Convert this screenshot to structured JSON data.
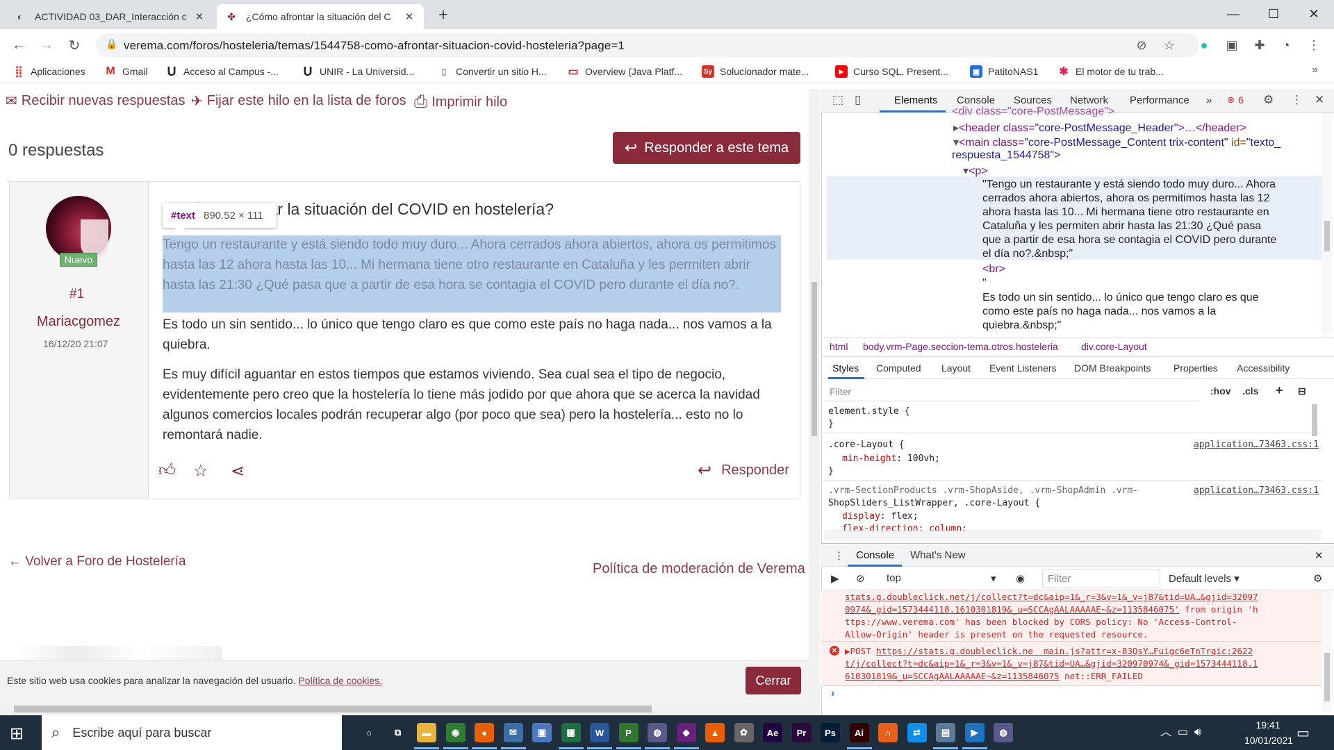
{
  "browser": {
    "tabs": [
      {
        "title": "ACTIVIDAD 03_DAR_Interacción c",
        "favicon": "moodle-icon",
        "active": false
      },
      {
        "title": "¿Cómo afrontar la situación del C",
        "favicon": "verema-icon",
        "active": true
      }
    ],
    "new_tab": "+",
    "window_controls": {
      "minimize": "—",
      "maximize": "☐",
      "close": "✕"
    },
    "url": "verema.com/foros/hosteleria/temas/1544758-como-afrontar-situacion-covid-hosteleria?page=1",
    "bookmarks": [
      {
        "label": "Aplicaciones",
        "icon": "apps-icon",
        "color": "#e94235"
      },
      {
        "label": "Gmail",
        "icon": "gmail-icon",
        "color": "#d93025"
      },
      {
        "label": "Acceso al Campus -...",
        "icon": "unir-icon",
        "color": "#222222"
      },
      {
        "label": "UNIR - La Universid...",
        "icon": "unir-icon",
        "color": "#222222"
      },
      {
        "label": "Convertir un sitio H...",
        "icon": "page-icon",
        "color": "#888888"
      },
      {
        "label": "Overview (Java Platf...",
        "icon": "oracle-icon",
        "color": "#e01b1b"
      },
      {
        "label": "Solucionador mate...",
        "icon": "symbolab-icon",
        "color": "#d93025"
      },
      {
        "label": "Curso SQL. Present...",
        "icon": "youtube-icon",
        "color": "#ff0000"
      },
      {
        "label": "PatitoNAS1",
        "icon": "nas-icon",
        "color": "#1e6fd9"
      },
      {
        "label": "El motor de tu trab...",
        "icon": "slack-icon",
        "color": "#4a154b"
      }
    ]
  },
  "page": {
    "recibir": "Recibir nuevas respuestas",
    "fijar": "Fijar este hilo en la lista de foros",
    "imprimir": "Imprimir hilo",
    "respuestas": "0 respuestas",
    "responder_tema": "Responder a este tema",
    "post": {
      "badge": "Nuevo",
      "number": "#1",
      "author": "Mariacgomez",
      "date": "16/12/20 21:07",
      "title": "¿Cómo afrontar la situación del COVID en hostelería?",
      "p1": "Tengo un restaurante y está siendo todo muy duro... Ahora cerrados ahora abiertos, ahora os permitimos hasta las 12 ahora hasta las 10... Mi hermana tiene otro restaurante en Cataluña y les permiten abrir hasta las 21:30 ¿Qué pasa que a partir de esa hora se contagia el COVID pero durante el día no?.",
      "p2": "Es todo un sin sentido... lo único que tengo claro es que como este país no haga nada... nos vamos a la quiebra.",
      "p3": "Es muy difícil aguantar en estos tiempos que estamos viviendo. Sea cual sea el tipo de negocio, evidentemente pero creo que la hostelería lo tiene más jodido por que ahora que se acerca la navidad algunos comercios locales podrán recuperar algo (por poco que sea) pero la hostelería... esto no lo remontará nadie.",
      "responder": "Responder"
    },
    "inspect_tooltip": {
      "tag": "#text",
      "dims": "890.52 × 111"
    },
    "volver": "Volver a Foro de Hostelería",
    "politica": "Política de moderación de Verema",
    "cookie": {
      "text": "Este sitio web usa cookies para analizar la navegación del usuario. ",
      "link": "Política de cookies.",
      "close": "Cerrar"
    }
  },
  "devtools": {
    "tabs": [
      "Elements",
      "Console",
      "Sources",
      "Network",
      "Performance"
    ],
    "more": "»",
    "error_count": "6",
    "dom": {
      "l0": "<div class=\"core-PostMessage\">",
      "l1_tag": "<header class=",
      "l1_val": "\"core-PostMessage_Header\"",
      "l1_end": ">…</header>",
      "l2_tag": "<main class=",
      "l2_val": "\"core-PostMessage_Content trix-content\"",
      "l2_attr": " id=",
      "l2_val2": "\"texto_",
      "l2b": "respuesta_1544758\">",
      "l3": "<p>",
      "t1": "\"Tengo un restaurante y está siendo todo muy duro... Ahora",
      "t2": "cerrados ahora abiertos, ahora os permitimos hasta las 12",
      "t3": "ahora hasta las 10... Mi hermana tiene otro restaurante en",
      "t4": "Cataluña y les permiten abrir hasta las 21:30 ¿Qué pasa",
      "t5": "que a partir de esa hora se contagia el COVID pero durante",
      "t6": "el día no?.&nbsp;\"",
      "br": "<br>",
      "q": "\"",
      "t7": "Es todo un sin sentido... lo único que tengo claro es que",
      "t8": "como este país no haga nada... nos vamos a la",
      "t9": "quiebra.&nbsp;\""
    },
    "breadcrumbs": [
      "html",
      "body.vrm-Page.seccion-tema.otros.hosteleria",
      "div.core-Layout"
    ],
    "styles_tabs": [
      "Styles",
      "Computed",
      "Layout",
      "Event Listeners",
      "DOM Breakpoints",
      "Properties",
      "Accessibility"
    ],
    "filter_placeholder": "Filter",
    "hov": ":hov",
    "cls": ".cls",
    "rules": {
      "r1_sel": "element.style {",
      "r1_end": "}",
      "r2_sel": ".core-Layout {",
      "r2_prop": "min-height",
      "r2_val": ": 100vh;",
      "r2_end": "}",
      "r2_src": "application…73463.css:1",
      "r3_sel": ".vrm-SectionProducts .vrm-ShopAside, .vrm-ShopAdmin .vrm-",
      "r3_sel2": "ShopSliders_ListWrapper, .core-Layout {",
      "r3_prop": "display",
      "r3_val": ": flex;",
      "r3_prop2": "flex-direction: column;",
      "r3_src": "application…73463.css:1"
    },
    "drawer_tabs": [
      "Console",
      "What's New"
    ],
    "console": {
      "context": "top",
      "filter": "Filter",
      "levels": "Default levels ▾",
      "e1a": "stats.g.doubleclick.net/j/collect?t=dc&aip=1&_r=3&v=1&_v=j87&tid=UA…&gjid=32097",
      "e1b": "0974&_gid=1573444118.1610301819&_u=SCCAgAALAAAAAE~&z=1135846075'",
      "e1b2": " from origin 'h",
      "e1c": "ttps://www.verema.com' has been blocked by CORS policy: No 'Access-Control-",
      "e1d": "Allow-Origin' header is present on the requested resource.",
      "e2_method": "▶POST ",
      "e2a": "https://stats.g.doubleclick.ne",
      "e2a2": "  main.js?attr=x-83QsY…Fuigc6eTnTrqic:2622",
      "e2b": "t/j/collect?t=dc&aip=1&_r=3&v=1&_v=j87&tid=UA…&gjid=320970974&_gid=1573444118.1",
      "e2c": "610301819&_u=SCCAgAALAAAAAE~&z=1135846075",
      "e2c2": " net::ERR_FAILED",
      "prompt": "›"
    }
  },
  "taskbar": {
    "search_placeholder": "Escribe aquí para buscar",
    "apps": [
      {
        "name": "cortana-icon",
        "label": "○",
        "color": "#1f2e3d"
      },
      {
        "name": "task-view-icon",
        "label": "⧉",
        "color": "#1f2e3d"
      },
      {
        "name": "file-explorer-icon",
        "label": "▬",
        "color": "#e8b43c"
      },
      {
        "name": "chrome-icon",
        "label": "◉",
        "color": "#2e7d32"
      },
      {
        "name": "firefox-icon",
        "label": "●",
        "color": "#e66000"
      },
      {
        "name": "mail-icon",
        "label": "✉",
        "color": "#3a6ea5"
      },
      {
        "name": "app-icon",
        "label": "▣",
        "color": "#4b78c0"
      },
      {
        "name": "excel-like-icon",
        "label": "▦",
        "color": "#1d6f42"
      },
      {
        "name": "word-icon",
        "label": "W",
        "color": "#2b579a"
      },
      {
        "name": "project-icon",
        "label": "P",
        "color": "#31752f"
      },
      {
        "name": "app2-icon",
        "label": "◍",
        "color": "#5a5a8a"
      },
      {
        "name": "visual-studio-icon",
        "label": "◆",
        "color": "#68217a"
      },
      {
        "name": "vlc-icon",
        "label": "▲",
        "color": "#e85e00"
      },
      {
        "name": "paint-icon",
        "label": "✿",
        "color": "#666666"
      },
      {
        "name": "after-effects-icon",
        "label": "Ae",
        "color": "#1f0740"
      },
      {
        "name": "premiere-icon",
        "label": "Pr",
        "color": "#2a0a3c"
      },
      {
        "name": "photoshop-icon",
        "label": "Ps",
        "color": "#001e36"
      },
      {
        "name": "illustrator-icon",
        "label": "Ai",
        "color": "#330000"
      },
      {
        "name": "headset-icon",
        "label": "∩",
        "color": "#e8611a"
      },
      {
        "name": "teamviewer-icon",
        "label": "⇄",
        "color": "#0e8ee9"
      },
      {
        "name": "app3-icon",
        "label": "▤",
        "color": "#5a7a9a"
      },
      {
        "name": "app4-icon",
        "label": "▶",
        "color": "#1e73be"
      },
      {
        "name": "app5-icon",
        "label": "◍",
        "color": "#5a5a8a"
      }
    ],
    "time": "19:41",
    "date": "10/01/2021"
  }
}
